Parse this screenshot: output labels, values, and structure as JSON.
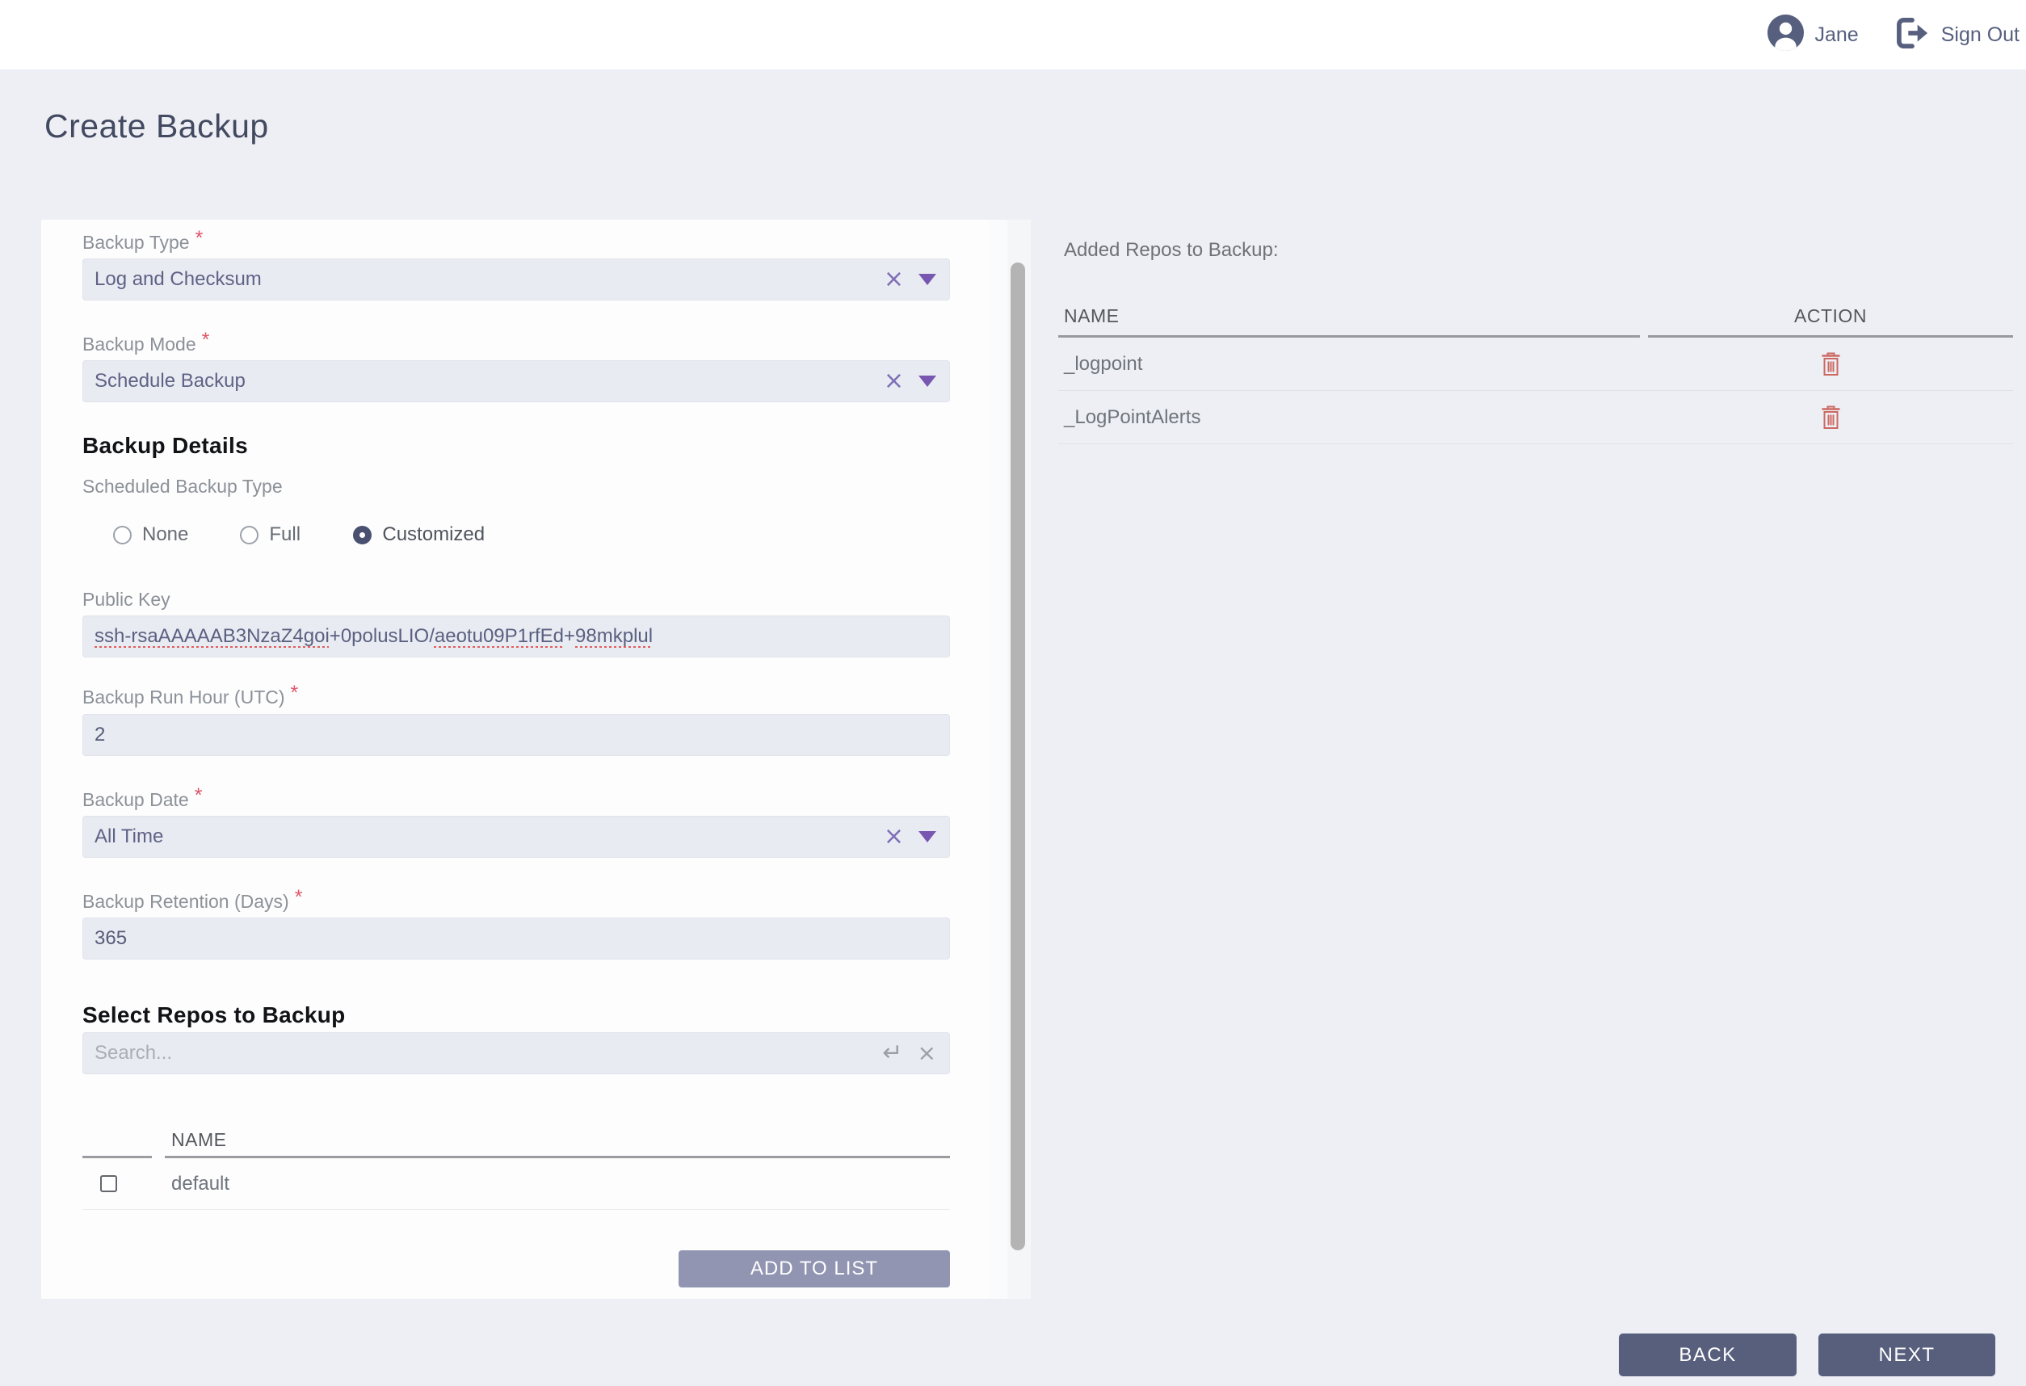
{
  "ui": {
    "required_marker": "*"
  },
  "header": {
    "user_name": "Jane",
    "sign_out_label": "Sign Out"
  },
  "page": {
    "title": "Create Backup"
  },
  "form": {
    "backup_type": {
      "label": "Backup Type",
      "value": "Log and Checksum"
    },
    "backup_mode": {
      "label": "Backup Mode",
      "value": "Schedule Backup"
    },
    "details_heading": "Backup Details",
    "scheduled_backup_type": {
      "label": "Scheduled Backup Type",
      "options": [
        "None",
        "Full",
        "Customized"
      ],
      "selected": "Customized"
    },
    "public_key": {
      "label": "Public Key",
      "value": "ssh-rsaAAAAAB3NzaZ4goi+0polusLIO/aeotu09P1rfEd+98mkplul",
      "segments": [
        {
          "text": "ssh-rsaAAAAAB3NzaZ4goi",
          "misspelled": true
        },
        {
          "text": "+0polusLIO/",
          "misspelled": false
        },
        {
          "text": "aeotu09P1rfEd",
          "misspelled": true
        },
        {
          "text": "+",
          "misspelled": false
        },
        {
          "text": "98mkplul",
          "misspelled": true
        }
      ]
    },
    "backup_run_hour": {
      "label": "Backup Run Hour (UTC)",
      "value": "2"
    },
    "backup_date": {
      "label": "Backup Date",
      "value": "All Time"
    },
    "backup_retention": {
      "label": "Backup Retention (Days)",
      "value": "365"
    },
    "select_repos": {
      "heading": "Select Repos to Backup",
      "search_placeholder": "Search...",
      "name_header": "NAME",
      "rows": [
        {
          "name": "default",
          "checked": false
        }
      ],
      "add_button_label": "ADD TO LIST"
    }
  },
  "added_repos": {
    "title": "Added Repos to Backup:",
    "name_header": "NAME",
    "action_header": "ACTION",
    "rows": [
      {
        "name": "_logpoint"
      },
      {
        "name": "_LogPointAlerts"
      }
    ]
  },
  "footer": {
    "back_label": "BACK",
    "next_label": "NEXT"
  },
  "icons": {
    "avatar": "user-avatar-icon",
    "sign_out": "sign-out-icon",
    "clear": "clear-x-icon",
    "dropdown": "chevron-down-icon",
    "search_enter": "enter-arrow-icon",
    "search_clear": "clear-x-icon",
    "delete": "trash-icon"
  },
  "colors": {
    "page_background": "#edeff4",
    "header_background": "#ffffff",
    "slate": "#565f7e",
    "title_text": "#424960",
    "field_background": "#e9ebf2",
    "dropdown_value_text": "#5e6285",
    "purple_icon": "#7a63b8",
    "required_red": "#e0556a",
    "spellcheck_red": "#e25c5c",
    "radio_checked": "#4a5070",
    "add_button_background": "#9195b2",
    "nav_button_background": "#575f7d",
    "trash_red": "#cc6862",
    "table_header_line": "#98999d"
  }
}
